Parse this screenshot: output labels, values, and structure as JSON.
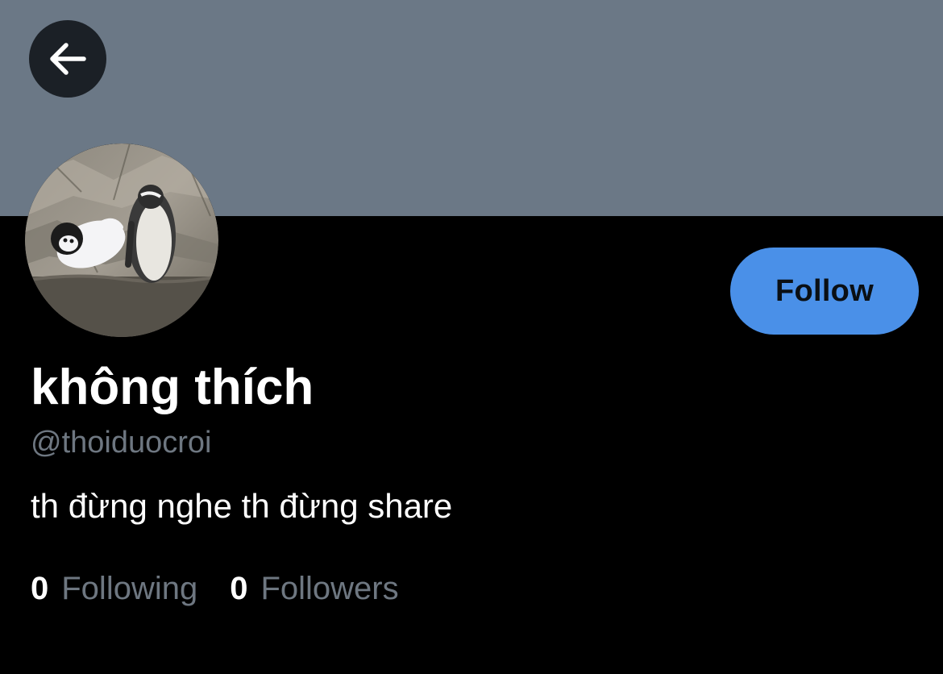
{
  "profile": {
    "display_name": "không thích",
    "handle": "@thoiduocroi",
    "bio": "th đừng nghe th đừng share",
    "avatar_icon": "penguin-photo-avatar"
  },
  "header": {
    "back_icon": "arrow-left-icon",
    "banner_color": "#6b7886"
  },
  "actions": {
    "follow_label": "Follow",
    "follow_color": "#4a90e8"
  },
  "stats": {
    "following_count": "0",
    "following_label": "Following",
    "followers_count": "0",
    "followers_label": "Followers"
  }
}
